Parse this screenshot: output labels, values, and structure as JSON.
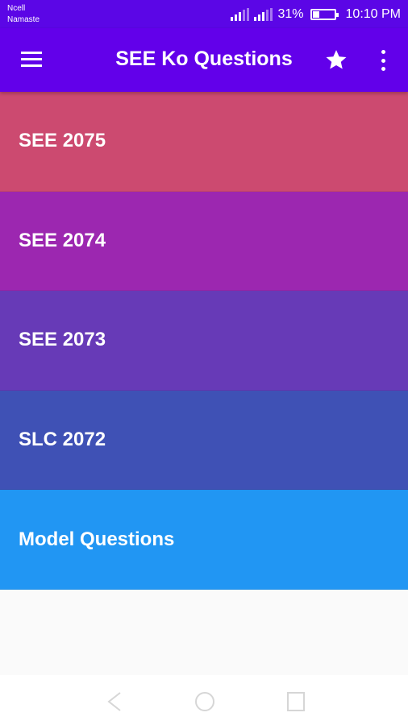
{
  "status_bar": {
    "carrier_line1": "Ncell",
    "carrier_line2": "Namaste",
    "battery_percent": "31%",
    "battery_level": 0.31,
    "time": "10:10 PM"
  },
  "app_bar": {
    "title": "SEE Ko Questions",
    "background": "#6200ea"
  },
  "list": {
    "items": [
      {
        "label": "SEE 2075",
        "color": "#cc4a70"
      },
      {
        "label": "SEE 2074",
        "color": "#9c27b0"
      },
      {
        "label": "SEE 2073",
        "color": "#673ab7"
      },
      {
        "label": "SLC 2072",
        "color": "#3f51b5"
      },
      {
        "label": "Model Questions",
        "color": "#2196f3"
      }
    ]
  },
  "nav_bar": {
    "icons": [
      "back-icon",
      "home-icon",
      "recents-icon"
    ]
  }
}
